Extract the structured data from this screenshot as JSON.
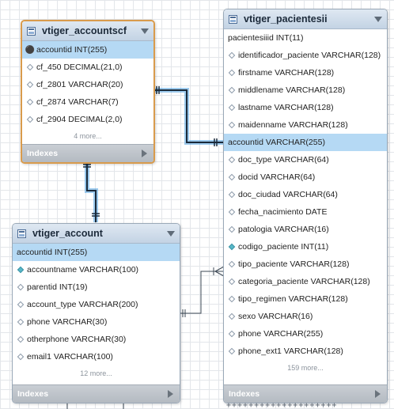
{
  "colors": {
    "accent_selected_border": "#d99b4c",
    "header_bg": "#c3d3e4",
    "highlight_row": "#b5d9f4",
    "relationship_line": "#1a2a3a",
    "relationship_glow": "#4fa0e0"
  },
  "tables": [
    {
      "title": "vtiger_accountscf",
      "selected": true,
      "fields": [
        {
          "label": "accountid INT(255)",
          "icon": "key-icon",
          "highlighted": true
        },
        {
          "label": "cf_450 DECIMAL(21,0)",
          "icon": "diamond-icon"
        },
        {
          "label": "cf_2801 VARCHAR(20)",
          "icon": "diamond-icon"
        },
        {
          "label": "cf_2874 VARCHAR(7)",
          "icon": "diamond-icon"
        },
        {
          "label": "cf_2904 DECIMAL(2,0)",
          "icon": "diamond-icon"
        }
      ],
      "more": "4 more...",
      "footer": "Indexes"
    },
    {
      "title": "vtiger_account",
      "selected": false,
      "fields": [
        {
          "label": "accountid INT(255)",
          "icon": "none",
          "highlighted": true
        },
        {
          "label": "accountname VARCHAR(100)",
          "icon": "filled-diamond-icon"
        },
        {
          "label": "parentid INT(19)",
          "icon": "diamond-icon"
        },
        {
          "label": "account_type VARCHAR(200)",
          "icon": "diamond-icon"
        },
        {
          "label": "phone VARCHAR(30)",
          "icon": "diamond-icon"
        },
        {
          "label": "otherphone VARCHAR(30)",
          "icon": "diamond-icon"
        },
        {
          "label": "email1 VARCHAR(100)",
          "icon": "diamond-icon"
        }
      ],
      "more": "12 more...",
      "footer": "Indexes"
    },
    {
      "title": "vtiger_pacientesii",
      "selected": false,
      "fields": [
        {
          "label": "pacientesiiid INT(11)",
          "icon": "none"
        },
        {
          "label": "identificador_paciente VARCHAR(128)",
          "icon": "diamond-icon"
        },
        {
          "label": "firstname VARCHAR(128)",
          "icon": "diamond-icon"
        },
        {
          "label": "middlename VARCHAR(128)",
          "icon": "diamond-icon"
        },
        {
          "label": "lastname VARCHAR(128)",
          "icon": "diamond-icon"
        },
        {
          "label": "maidenname VARCHAR(128)",
          "icon": "diamond-icon"
        },
        {
          "label": "accountid VARCHAR(255)",
          "icon": "none",
          "highlighted": true
        },
        {
          "label": "doc_type VARCHAR(64)",
          "icon": "diamond-icon"
        },
        {
          "label": "docid VARCHAR(64)",
          "icon": "diamond-icon"
        },
        {
          "label": "doc_ciudad VARCHAR(64)",
          "icon": "diamond-icon"
        },
        {
          "label": "fecha_nacimiento DATE",
          "icon": "diamond-icon"
        },
        {
          "label": "patologia VARCHAR(16)",
          "icon": "diamond-icon"
        },
        {
          "label": "codigo_paciente INT(11)",
          "icon": "filled-diamond-icon"
        },
        {
          "label": "tipo_paciente VARCHAR(128)",
          "icon": "diamond-icon"
        },
        {
          "label": "categoria_paciente VARCHAR(128)",
          "icon": "diamond-icon"
        },
        {
          "label": "tipo_regimen VARCHAR(128)",
          "icon": "diamond-icon"
        },
        {
          "label": "sexo VARCHAR(16)",
          "icon": "diamond-icon"
        },
        {
          "label": "phone VARCHAR(255)",
          "icon": "diamond-icon"
        },
        {
          "label": "phone_ext1 VARCHAR(128)",
          "icon": "diamond-icon"
        }
      ],
      "more": "159 more...",
      "footer": "Indexes"
    }
  ]
}
